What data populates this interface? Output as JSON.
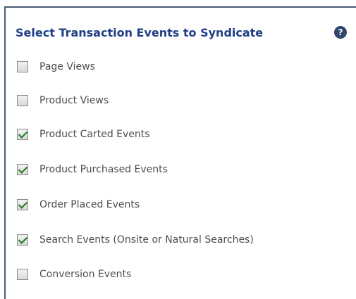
{
  "panel": {
    "title": "Select Transaction Events to Syndicate",
    "help_icon": "?"
  },
  "options": [
    {
      "label": "Page Views",
      "checked": false
    },
    {
      "label": "Product Views",
      "checked": false
    },
    {
      "label": "Product Carted Events",
      "checked": true
    },
    {
      "label": "Product Purchased Events",
      "checked": true
    },
    {
      "label": "Order Placed Events",
      "checked": true
    },
    {
      "label": "Search Events (Onsite or Natural Searches)",
      "checked": true
    },
    {
      "label": "Conversion Events",
      "checked": false
    }
  ]
}
